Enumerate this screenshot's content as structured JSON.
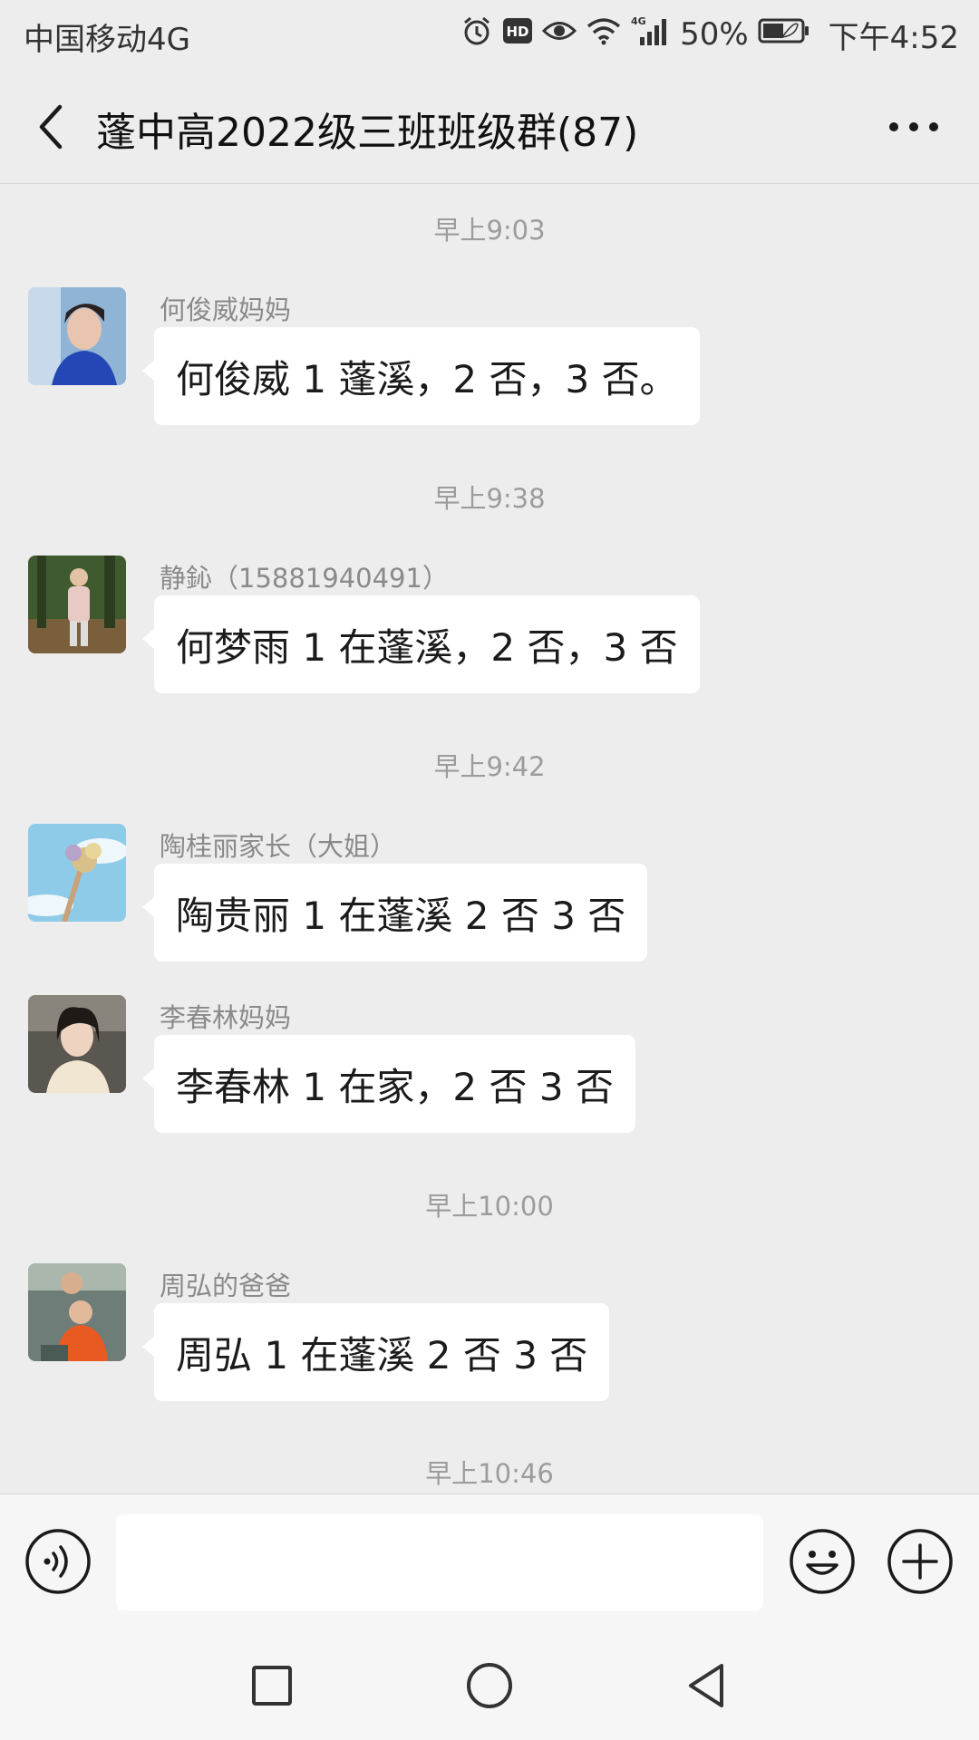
{
  "status_bar": {
    "carrier": "中国移动4G",
    "network_badge": "4G",
    "battery_percent": "50%",
    "time": "下午4:52",
    "icons": [
      "alarm-icon",
      "hd-icon",
      "eye-icon",
      "wifi-icon",
      "signal-icon",
      "battery-icon"
    ]
  },
  "nav": {
    "title": "蓬中高2022级三班班级群(87)",
    "back_icon": "chevron-left-icon",
    "more_icon": "more-dots-icon"
  },
  "messages": [
    {
      "time": "早上9:03",
      "sender": "何俊威妈妈",
      "text": "何俊威 1 蓬溪，2 否，3 否。"
    },
    {
      "time": "早上9:38",
      "sender": "静鈊（15881940491）",
      "text": "何梦雨 1 在蓬溪，2 否，3 否"
    },
    {
      "time": "早上9:42",
      "sender": "陶桂丽家长（大姐）",
      "text": "陶贵丽 1 在蓬溪 2 否 3 否"
    },
    {
      "time": "",
      "sender": "李春林妈妈",
      "text": "李春林 1 在家，2 否 3 否"
    },
    {
      "time": "早上10:00",
      "sender": "周弘的爸爸",
      "text": "周弘 1 在蓬溪 2 否 3 否"
    }
  ],
  "trailing_time": "早上10:46",
  "input_bar": {
    "placeholder": "",
    "voice_icon": "voice-icon",
    "emoji_icon": "emoji-icon",
    "plus_icon": "plus-icon"
  },
  "system_nav": {
    "icons": [
      "recent-apps-icon",
      "home-icon",
      "back-triangle-icon"
    ]
  },
  "colors": {
    "background": "#ededed",
    "bubble": "#ffffff",
    "time_text": "#9c9c9c",
    "sender_text": "#8a8a8a"
  }
}
